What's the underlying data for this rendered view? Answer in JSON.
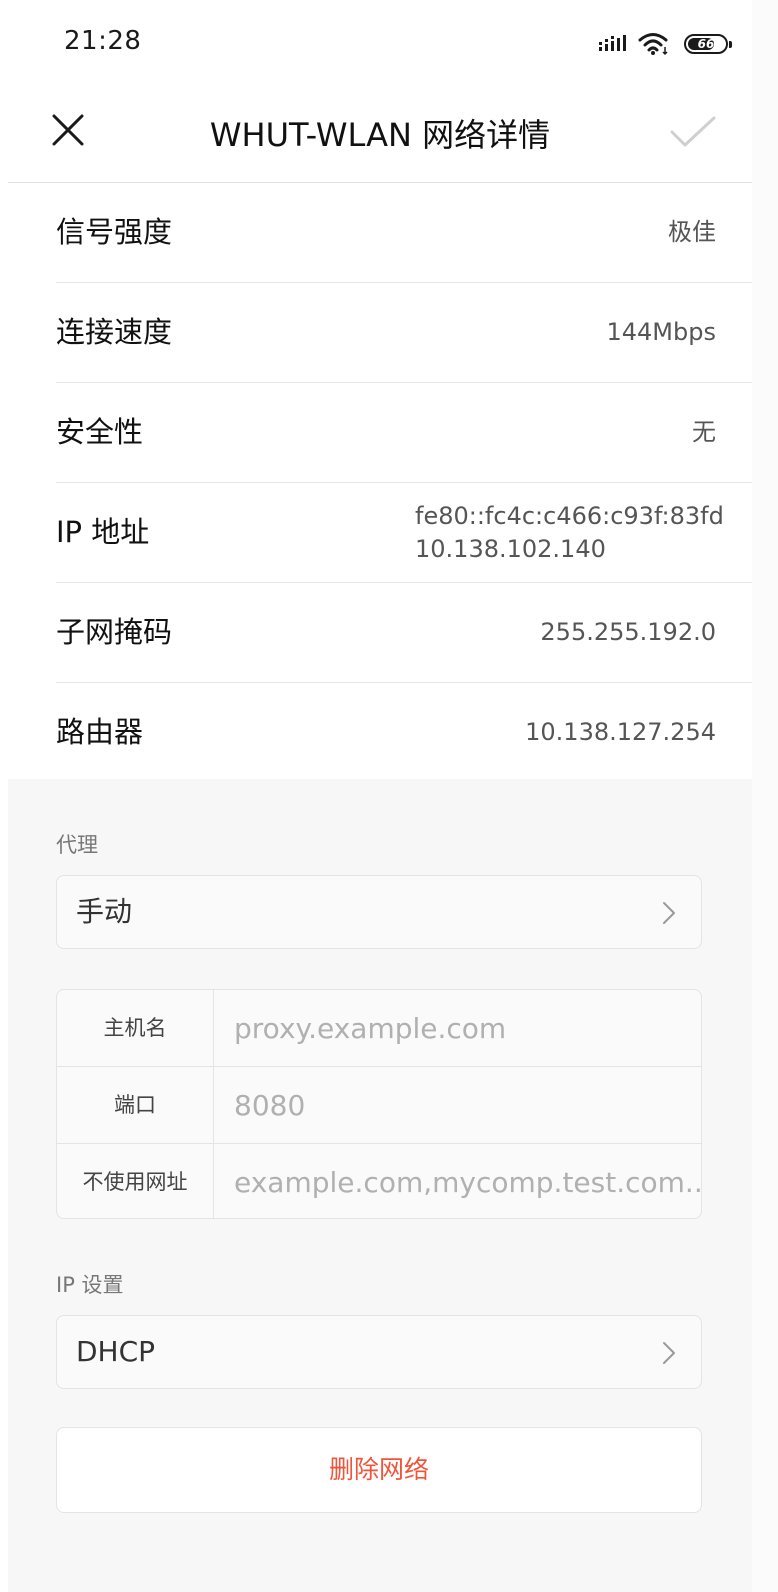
{
  "status_bar": {
    "time": "21:28",
    "battery_level": "66",
    "icons": [
      "signal-icon",
      "wifi-icon",
      "battery-icon"
    ]
  },
  "header": {
    "title": "WHUT-WLAN 网络详情",
    "close_icon": "close-icon",
    "confirm_icon": "check-icon"
  },
  "details": {
    "signal": {
      "label": "信号强度",
      "value": "极佳"
    },
    "speed": {
      "label": "连接速度",
      "value": "144Mbps"
    },
    "security": {
      "label": "安全性",
      "value": "无"
    },
    "ip": {
      "label": "IP 地址",
      "value_ipv6": "fe80::fc4c:c466:c93f:83fd",
      "value_ipv4": "10.138.102.140"
    },
    "subnet": {
      "label": "子网掩码",
      "value": "255.255.192.0"
    },
    "router": {
      "label": "路由器",
      "value": "10.138.127.254"
    }
  },
  "proxy": {
    "section_label": "代理",
    "mode": "手动",
    "hostname": {
      "label": "主机名",
      "placeholder": "proxy.example.com"
    },
    "port": {
      "label": "端口",
      "placeholder": "8080"
    },
    "bypass": {
      "label": "不使用网址",
      "placeholder": "example.com,mycomp.test.com..."
    }
  },
  "ip_settings": {
    "section_label": "IP 设置",
    "mode": "DHCP"
  },
  "actions": {
    "delete_label": "删除网络"
  },
  "colors": {
    "danger": "#f0553a",
    "section_bg": "#f7f7f7",
    "divider": "#e6e6e6"
  }
}
